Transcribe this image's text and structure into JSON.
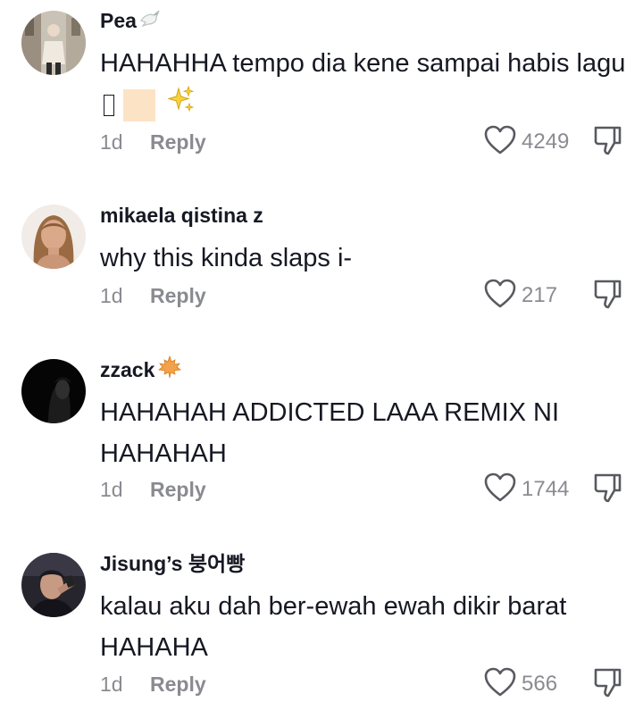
{
  "comments": [
    {
      "username": "Pea",
      "badge": "dove-icon",
      "text": "HAHAHHA tempo dia kene sampai habis lagu",
      "text_suffix_icons": [
        "missing-glyph-icon",
        "skin-tone-emoji-icon",
        "sparkles-icon"
      ],
      "time": "1d",
      "reply_label": "Reply",
      "likes": "4249"
    },
    {
      "username": "mikaela qistina z",
      "text": "why this kinda slaps i-",
      "time": "1d",
      "reply_label": "Reply",
      "likes": "217"
    },
    {
      "username": "zzack",
      "badge": "maple-leaf-icon",
      "text": "HAHAHAH ADDICTED LAAA REMIX NI HAHAHAH",
      "time": "1d",
      "reply_label": "Reply",
      "likes": "1744"
    },
    {
      "username": "Jisung’s 붕어빵",
      "text": "kalau aku dah ber-ewah ewah dikir barat HAHAHA",
      "time": "1d",
      "reply_label": "Reply",
      "likes": "566"
    }
  ],
  "colors": {
    "text": "#161823",
    "secondary": "#8a8b91",
    "background": "#ffffff"
  }
}
